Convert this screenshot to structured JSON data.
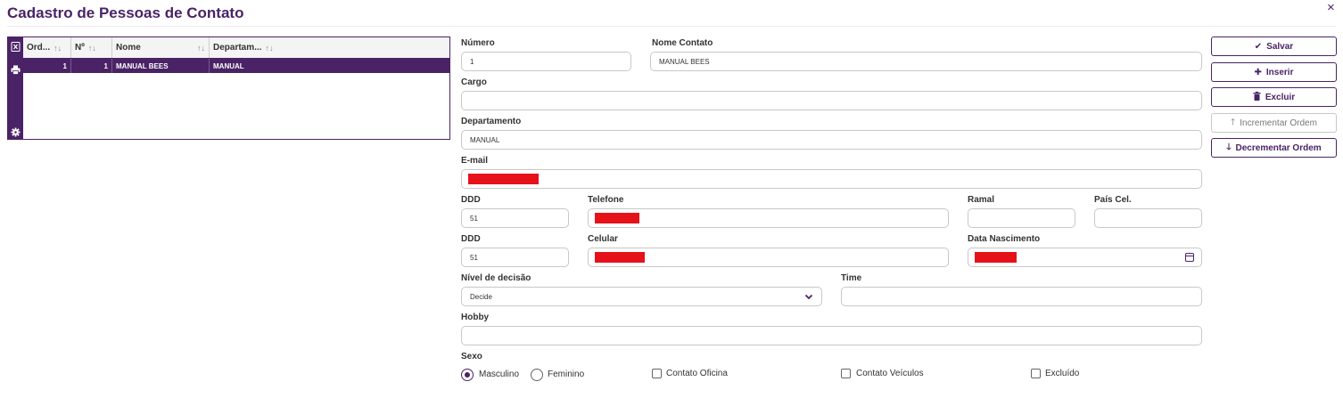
{
  "window": {
    "title": "Cadastro de Pessoas de Contato",
    "close_label": "×"
  },
  "grid": {
    "side_icons": [
      "excel-export-icon",
      "print-icon",
      "gear-icon"
    ],
    "columns": [
      "Ord...",
      "Nº",
      "Nome",
      "Departam..."
    ],
    "sort_glyph": "↑↓",
    "rows": [
      {
        "ord": "1",
        "num": "1",
        "nome": "MANUAL BEES",
        "departamento": "MANUAL"
      }
    ]
  },
  "form": {
    "numero": {
      "label": "Número",
      "value": "1"
    },
    "nome_contato": {
      "label": "Nome Contato",
      "value": "MANUAL BEES"
    },
    "cargo": {
      "label": "Cargo",
      "value": ""
    },
    "departamento": {
      "label": "Departamento",
      "value": "MANUAL"
    },
    "email": {
      "label": "E-mail",
      "value": ""
    },
    "ddd_tel": {
      "label": "DDD",
      "value": "51"
    },
    "telefone": {
      "label": "Telefone",
      "value": ""
    },
    "ramal": {
      "label": "Ramal",
      "value": ""
    },
    "pais_cel": {
      "label": "País Cel.",
      "value": ""
    },
    "ddd_cel": {
      "label": "DDD",
      "value": "51"
    },
    "celular": {
      "label": "Celular",
      "value": ""
    },
    "data_nascimento": {
      "label": "Data Nascimento",
      "value": ""
    },
    "nivel_decisao": {
      "label": "Nível de decisão",
      "value": "Decide"
    },
    "time": {
      "label": "Time",
      "value": ""
    },
    "hobby": {
      "label": "Hobby",
      "value": ""
    },
    "sexo": {
      "label": "Sexo",
      "options": [
        "Masculino",
        "Feminino"
      ],
      "selected": "Masculino"
    },
    "checkboxes": {
      "oficina": "Contato Oficina",
      "veiculos": "Contato Veículos",
      "excluido": "Excluído"
    }
  },
  "buttons": {
    "salvar": "Salvar",
    "inserir": "Inserir",
    "excluir": "Excluir",
    "incrementar": "Incrementar Ordem",
    "decrementar": "Decrementar Ordem"
  },
  "colors": {
    "primary": "#4a2366",
    "redaction": "#e6121a",
    "border": "#c8c8c8"
  }
}
